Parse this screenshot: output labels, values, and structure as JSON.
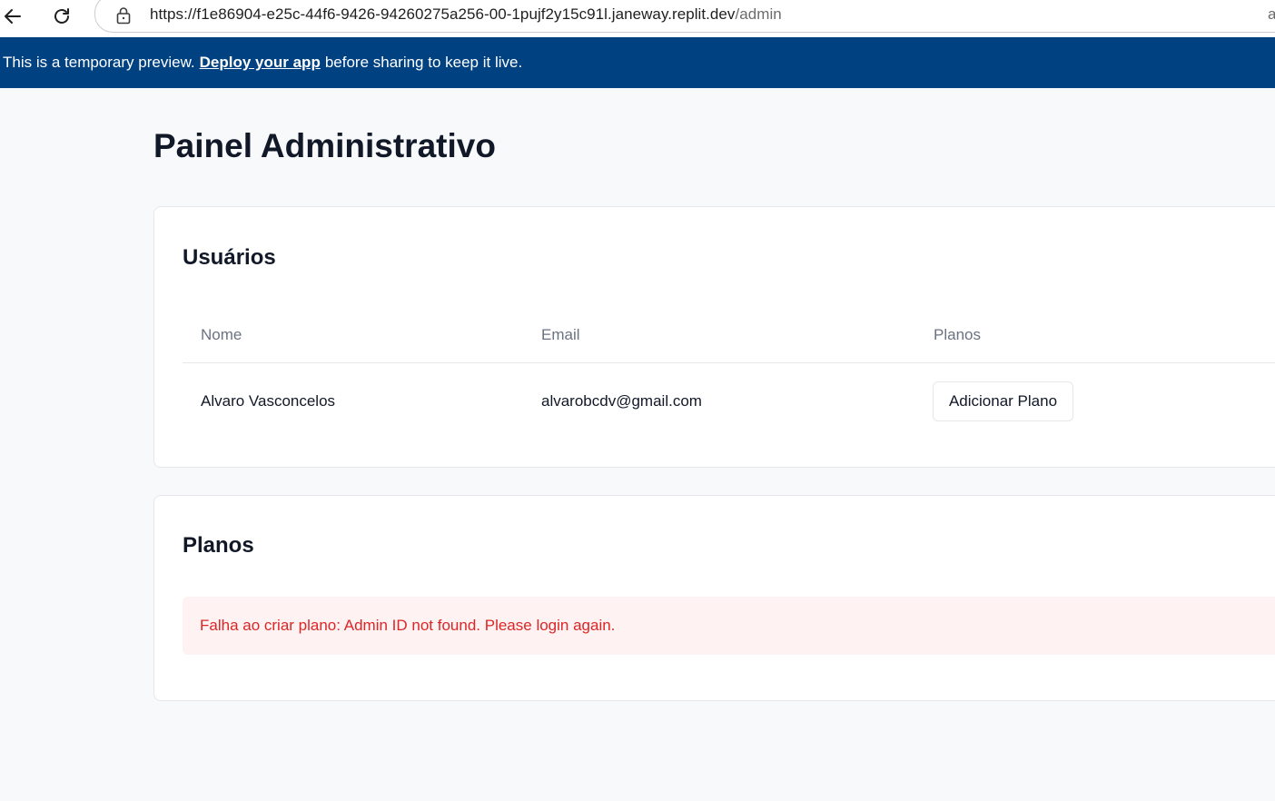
{
  "browser": {
    "url_host": "https://f1e86904-e25c-44f6-9426-94260275a256-00-1pujf2y15c91l.janeway.replit.dev",
    "url_path": "/admin",
    "url_extra": "a"
  },
  "banner": {
    "prefix": "This is a temporary preview.",
    "link": "Deploy your app",
    "suffix": "before sharing to keep it live."
  },
  "page": {
    "title": "Painel Administrativo"
  },
  "users": {
    "title": "Usuários",
    "columns": {
      "name": "Nome",
      "email": "Email",
      "plans": "Planos"
    },
    "rows": [
      {
        "name": "Alvaro Vasconcelos",
        "email": "alvarobcdv@gmail.com",
        "action": "Adicionar Plano"
      }
    ]
  },
  "plans": {
    "title": "Planos",
    "error": "Falha ao criar plano: Admin ID not found. Please login again."
  },
  "colors": {
    "banner_bg": "#004182",
    "error_text": "#dc2626",
    "error_bg": "#fef2f2"
  }
}
